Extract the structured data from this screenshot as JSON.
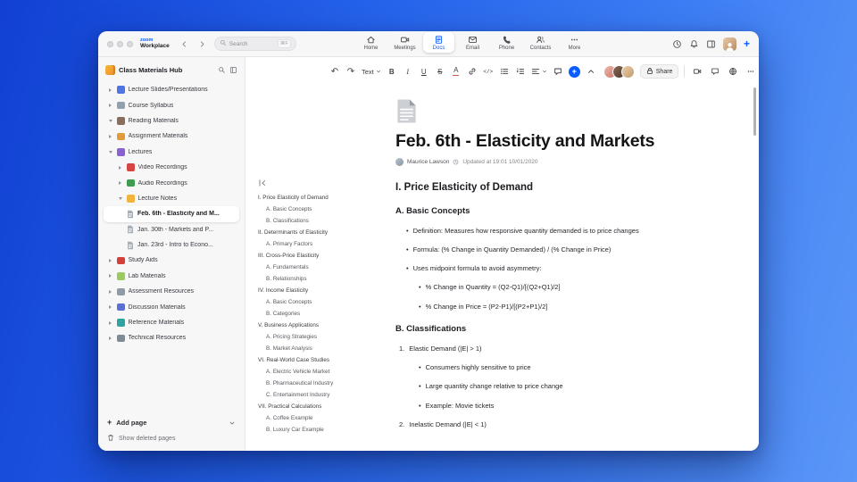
{
  "titlebar": {
    "brand_top": "zoom",
    "brand_bottom": "Workplace",
    "search_placeholder": "Search",
    "search_shortcut": "⌘F"
  },
  "topnav": {
    "items": [
      {
        "label": "Home",
        "active": false
      },
      {
        "label": "Meetings",
        "active": false
      },
      {
        "label": "Docs",
        "active": true
      },
      {
        "label": "Email",
        "active": false
      },
      {
        "label": "Phone",
        "active": false
      },
      {
        "label": "Contacts",
        "active": false
      },
      {
        "label": "More",
        "active": false
      }
    ]
  },
  "icons": {
    "undo": "↶",
    "redo": "↷",
    "plus": "+"
  },
  "colors": {
    "accent": "#0b5cff"
  },
  "sidebar": {
    "title": "Class Materials Hub",
    "items": [
      {
        "label": "Lecture Slides/Presentations"
      },
      {
        "label": "Course Syllabus"
      },
      {
        "label": "Reading Materials"
      },
      {
        "label": "Assignment Materials"
      },
      {
        "label": "Lectures"
      },
      {
        "label": "Video Recordings"
      },
      {
        "label": "Audio Recordings"
      },
      {
        "label": "Lecture Notes"
      },
      {
        "label": "Feb. 6th - Elasticity and M..."
      },
      {
        "label": "Jan. 30th - Markets and P..."
      },
      {
        "label": "Jan. 23rd - Intro to Econo..."
      },
      {
        "label": "Study Aids"
      },
      {
        "label": "Lab Materials"
      },
      {
        "label": "Assessment Resources"
      },
      {
        "label": "Discussion Materials"
      },
      {
        "label": "Reference Materials"
      },
      {
        "label": "Technical Resources"
      }
    ],
    "add_page": "Add page",
    "show_deleted": "Show deleted pages"
  },
  "toolbar": {
    "text_style": "Text",
    "bold": "B",
    "italic": "I",
    "underline": "U",
    "strike": "S",
    "color": "A",
    "code": "</>",
    "share": "Share"
  },
  "document": {
    "title": "Feb. 6th - Elasticity and Markets",
    "author": "Maurice Lawson",
    "updated": "Updated at 19:01 10/01/2020",
    "outline": [
      {
        "label": "I. Price Elasticity of Demand",
        "level": 0
      },
      {
        "label": "A. Basic Concepts",
        "level": 1
      },
      {
        "label": "B. Classifications",
        "level": 1
      },
      {
        "label": "II. Determinants of Elasticity",
        "level": 0
      },
      {
        "label": "A. Primary Factors",
        "level": 1
      },
      {
        "label": "III. Cross-Price Elasticity",
        "level": 0
      },
      {
        "label": "A. Fundamentals",
        "level": 1
      },
      {
        "label": "B. Relationships",
        "level": 1
      },
      {
        "label": "IV. Income Elasticity",
        "level": 0
      },
      {
        "label": "A. Basic Concepts",
        "level": 1
      },
      {
        "label": "B. Categories",
        "level": 1
      },
      {
        "label": "V. Business Applications",
        "level": 0
      },
      {
        "label": "A. Pricing Strategies",
        "level": 1
      },
      {
        "label": "B. Market Analysis",
        "level": 1
      },
      {
        "label": "VI. Real-World Case Studies",
        "level": 0
      },
      {
        "label": "A. Electric Vehicle Market",
        "level": 1
      },
      {
        "label": "B. Pharmaceutical Industry",
        "level": 1
      },
      {
        "label": "C. Entertainment Industry",
        "level": 1
      },
      {
        "label": "VII. Practical Calculations",
        "level": 0
      },
      {
        "label": "A. Coffee Example",
        "level": 1
      },
      {
        "label": "B. Luxury Car Example",
        "level": 1
      }
    ],
    "content": {
      "h1": "I. Price Elasticity of Demand",
      "h2_a": "A. Basic Concepts",
      "bullets": [
        "Definition: Measures how responsive quantity demanded is to price changes",
        "Formula: (% Change in Quantity Demanded) / (% Change in Price)",
        "Uses midpoint formula to avoid asymmetry:"
      ],
      "sub_bullets": [
        "% Change in Quantity = (Q2-Q1)/[(Q2+Q1)/2]",
        "% Change in Price = (P2-P1)/[(P2+P1)/2]"
      ],
      "h2_b": "B. Classifications",
      "numbered": [
        {
          "num": "1.",
          "text": "Elastic Demand (|E| > 1)",
          "subs": [
            "Consumers highly sensitive to price",
            "Large quantity change relative to price change",
            "Example: Movie tickets"
          ]
        },
        {
          "num": "2.",
          "text": "Inelastic Demand (|E| < 1)",
          "subs": []
        }
      ]
    }
  }
}
